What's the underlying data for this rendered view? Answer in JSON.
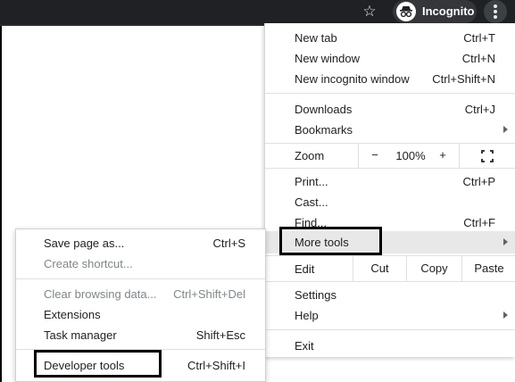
{
  "toolbar": {
    "star_icon": "star-icon",
    "incognito_label": "Incognito",
    "menu_icon": "kebab-menu-icon"
  },
  "menu": {
    "new_tab": {
      "label": "New tab",
      "shortcut": "Ctrl+T"
    },
    "new_window": {
      "label": "New window",
      "shortcut": "Ctrl+N"
    },
    "new_incognito": {
      "label": "New incognito window",
      "shortcut": "Ctrl+Shift+N"
    },
    "downloads": {
      "label": "Downloads",
      "shortcut": "Ctrl+J"
    },
    "bookmarks": {
      "label": "Bookmarks"
    },
    "zoom": {
      "label": "Zoom",
      "minus": "−",
      "value": "100%",
      "plus": "+",
      "fullscreen_icon": "fullscreen-icon"
    },
    "print": {
      "label": "Print...",
      "shortcut": "Ctrl+P"
    },
    "cast": {
      "label": "Cast..."
    },
    "find": {
      "label": "Find...",
      "shortcut": "Ctrl+F"
    },
    "more_tools": {
      "label": "More tools"
    },
    "edit": {
      "label": "Edit",
      "cut": "Cut",
      "copy": "Copy",
      "paste": "Paste"
    },
    "settings": {
      "label": "Settings"
    },
    "help": {
      "label": "Help"
    },
    "exit": {
      "label": "Exit"
    }
  },
  "submenu": {
    "save_page": {
      "label": "Save page as...",
      "shortcut": "Ctrl+S"
    },
    "create_shortcut": {
      "label": "Create shortcut..."
    },
    "clear_data": {
      "label": "Clear browsing data...",
      "shortcut": "Ctrl+Shift+Del"
    },
    "extensions": {
      "label": "Extensions"
    },
    "task_manager": {
      "label": "Task manager",
      "shortcut": "Shift+Esc"
    },
    "developer_tools": {
      "label": "Developer tools",
      "shortcut": "Ctrl+Shift+I"
    }
  }
}
